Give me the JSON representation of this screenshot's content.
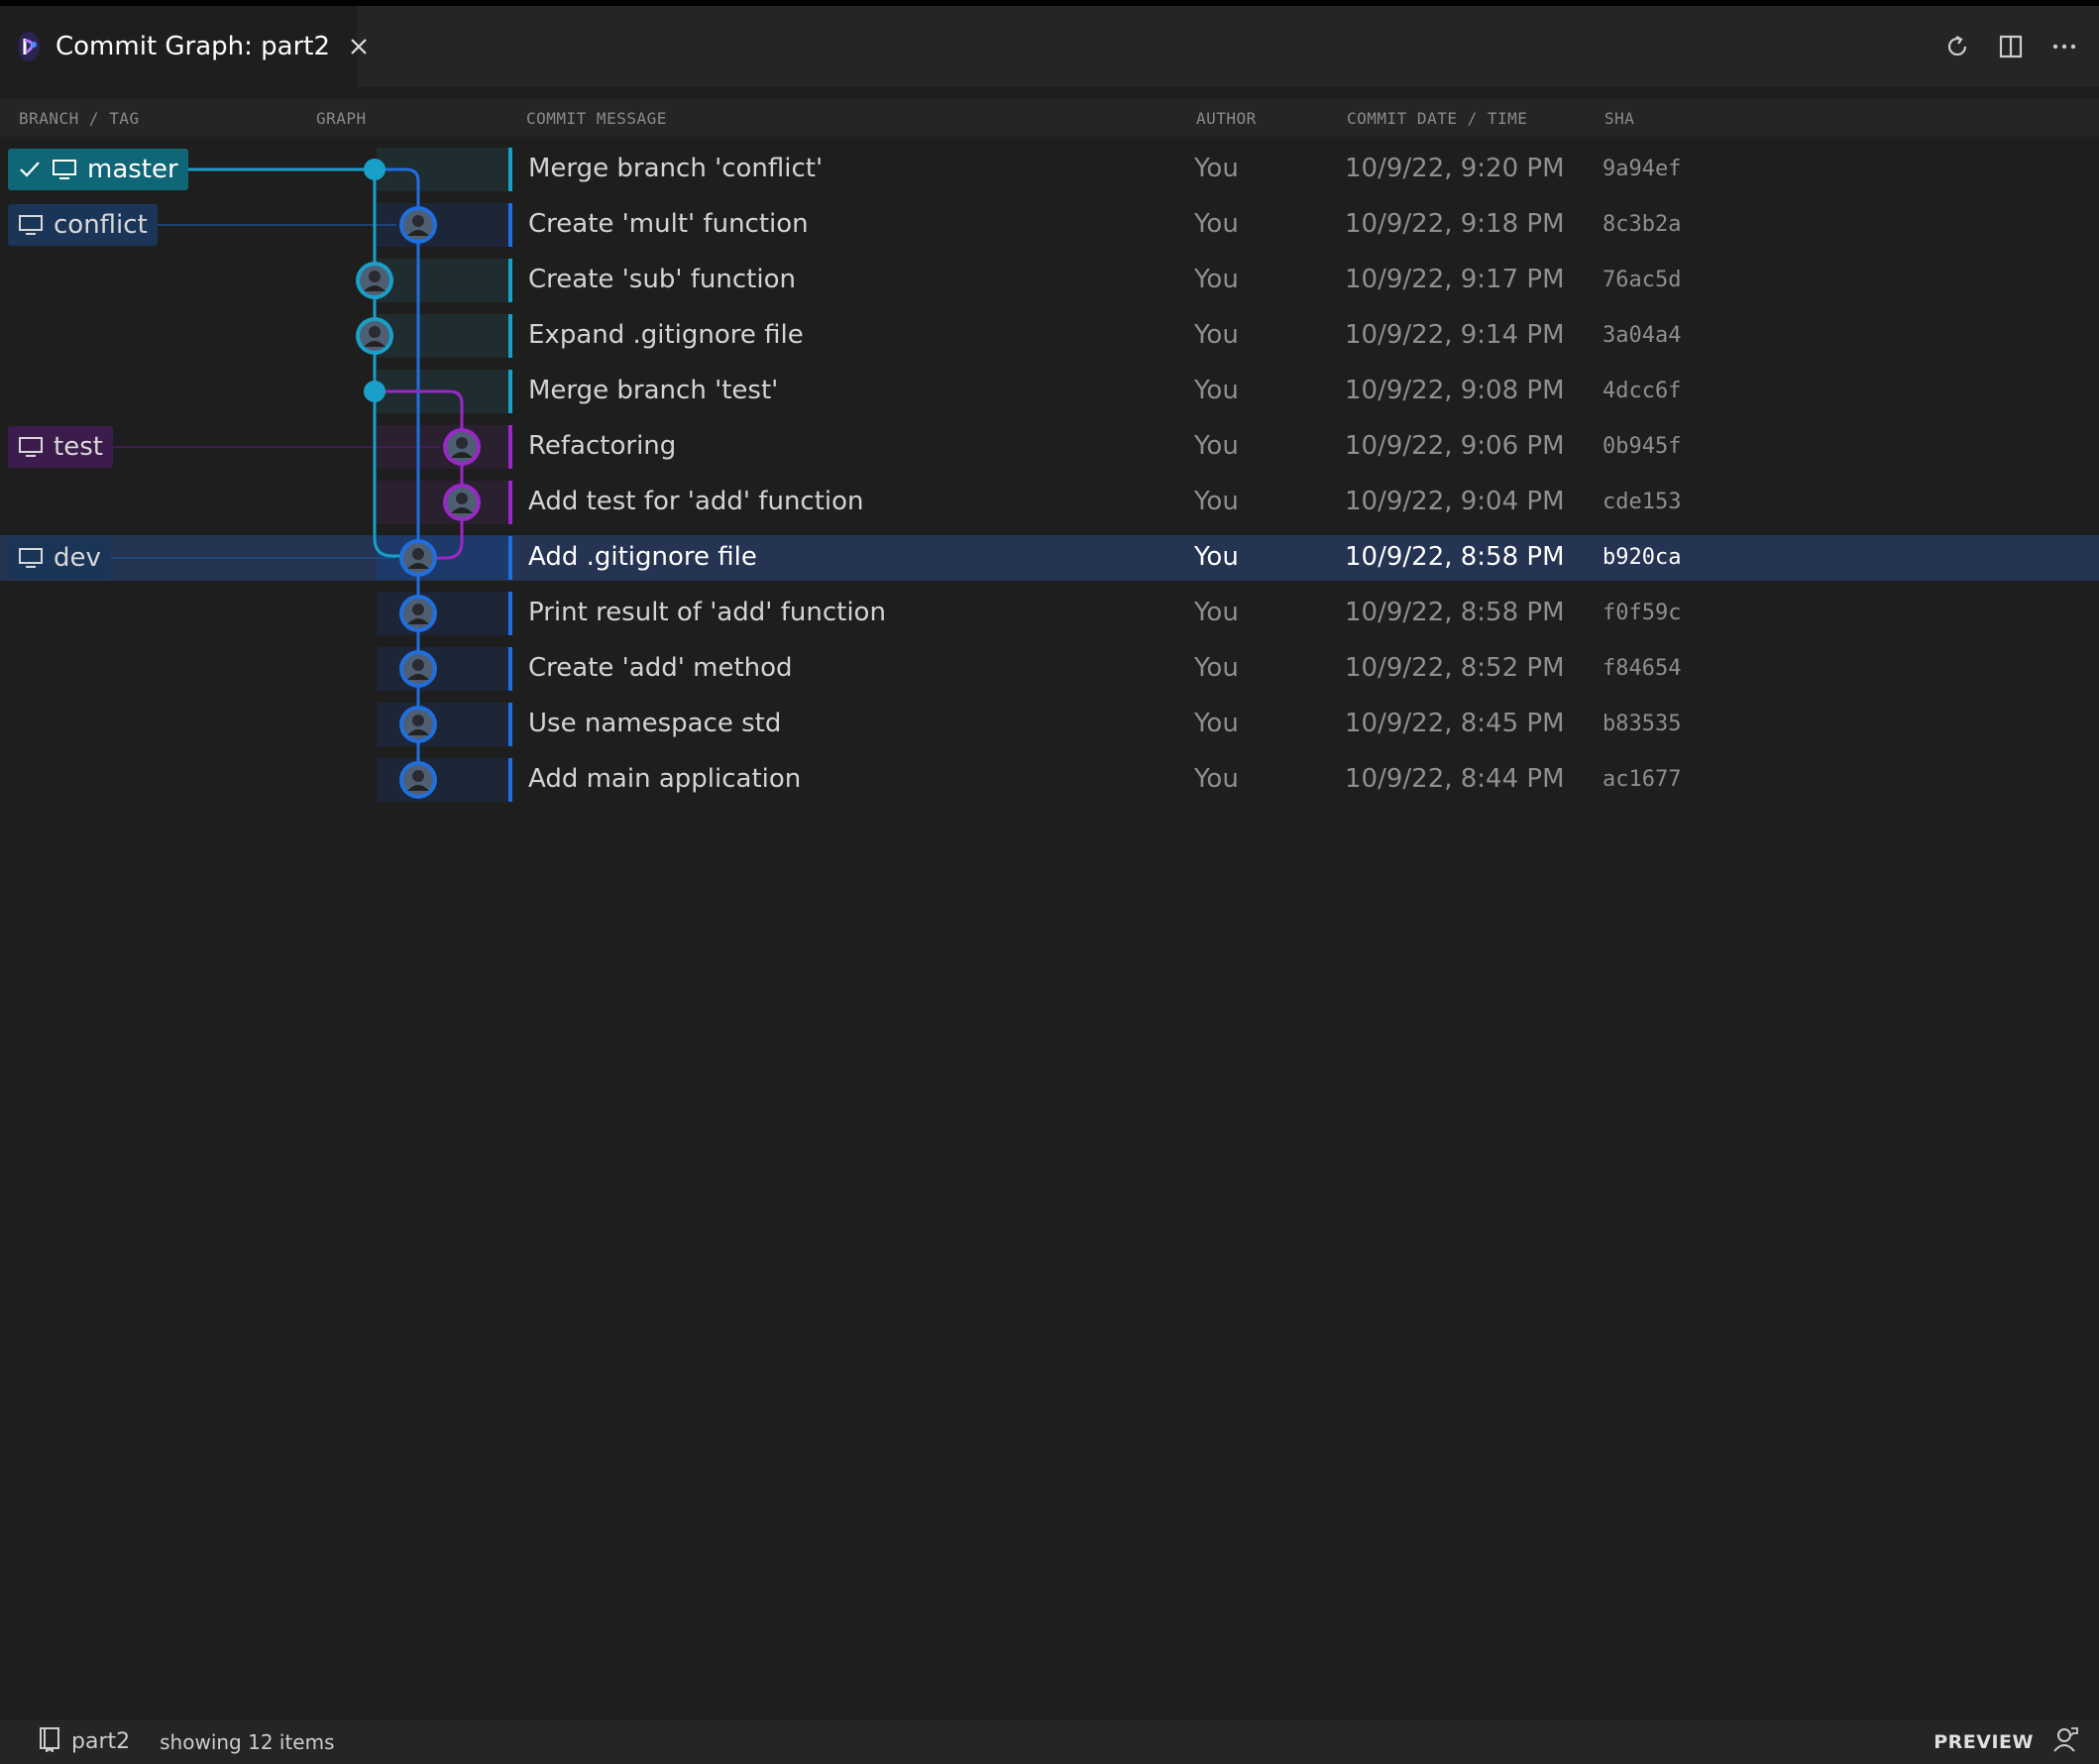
{
  "tab": {
    "title": "Commit Graph: part2",
    "icon": "gitlens-graph-icon"
  },
  "title_actions": [
    {
      "name": "refresh-icon"
    },
    {
      "name": "split-editor-icon"
    },
    {
      "name": "more-actions-icon"
    }
  ],
  "columns": {
    "branch": "BRANCH / TAG",
    "graph": "GRAPH",
    "message": "COMMIT MESSAGE",
    "author": "AUTHOR",
    "date": "COMMIT DATE / TIME",
    "sha": "SHA"
  },
  "branches": {
    "master": "master",
    "conflict": "conflict",
    "test": "test",
    "dev": "dev"
  },
  "commits": [
    {
      "message": "Merge branch 'conflict'",
      "author": "You",
      "date": "10/9/22, 9:20 PM",
      "sha": "9a94ef"
    },
    {
      "message": "Create 'mult' function",
      "author": "You",
      "date": "10/9/22, 9:18 PM",
      "sha": "8c3b2a"
    },
    {
      "message": "Create 'sub' function",
      "author": "You",
      "date": "10/9/22, 9:17 PM",
      "sha": "76ac5d"
    },
    {
      "message": "Expand .gitignore file",
      "author": "You",
      "date": "10/9/22, 9:14 PM",
      "sha": "3a04a4"
    },
    {
      "message": "Merge branch 'test'",
      "author": "You",
      "date": "10/9/22, 9:08 PM",
      "sha": "4dcc6f"
    },
    {
      "message": "Refactoring",
      "author": "You",
      "date": "10/9/22, 9:06 PM",
      "sha": "0b945f"
    },
    {
      "message": "Add test for 'add' function",
      "author": "You",
      "date": "10/9/22, 9:04 PM",
      "sha": "cde153"
    },
    {
      "message": "Add .gitignore file",
      "author": "You",
      "date": "10/9/22, 8:58 PM",
      "sha": "b920ca"
    },
    {
      "message": "Print result of 'add' function",
      "author": "You",
      "date": "10/9/22, 8:58 PM",
      "sha": "f0f59c"
    },
    {
      "message": "Create 'add' method",
      "author": "You",
      "date": "10/9/22, 8:52 PM",
      "sha": "f84654"
    },
    {
      "message": "Use namespace std",
      "author": "You",
      "date": "10/9/22, 8:45 PM",
      "sha": "b83535"
    },
    {
      "message": "Add main application",
      "author": "You",
      "date": "10/9/22, 8:44 PM",
      "sha": "ac1677"
    }
  ],
  "selected_commit": "b920ca",
  "status": {
    "repo": "part2",
    "count": "showing 12 items",
    "preview": "PREVIEW"
  },
  "colors": {
    "master_lane": "#19a0c8",
    "dev_lane": "#1f6fe0",
    "test_lane": "#9b27c8",
    "master_chip": "#0f6677",
    "dev_chip": "#1a3558",
    "test_chip": "#3c1c4c",
    "selected_row": "#243452"
  }
}
